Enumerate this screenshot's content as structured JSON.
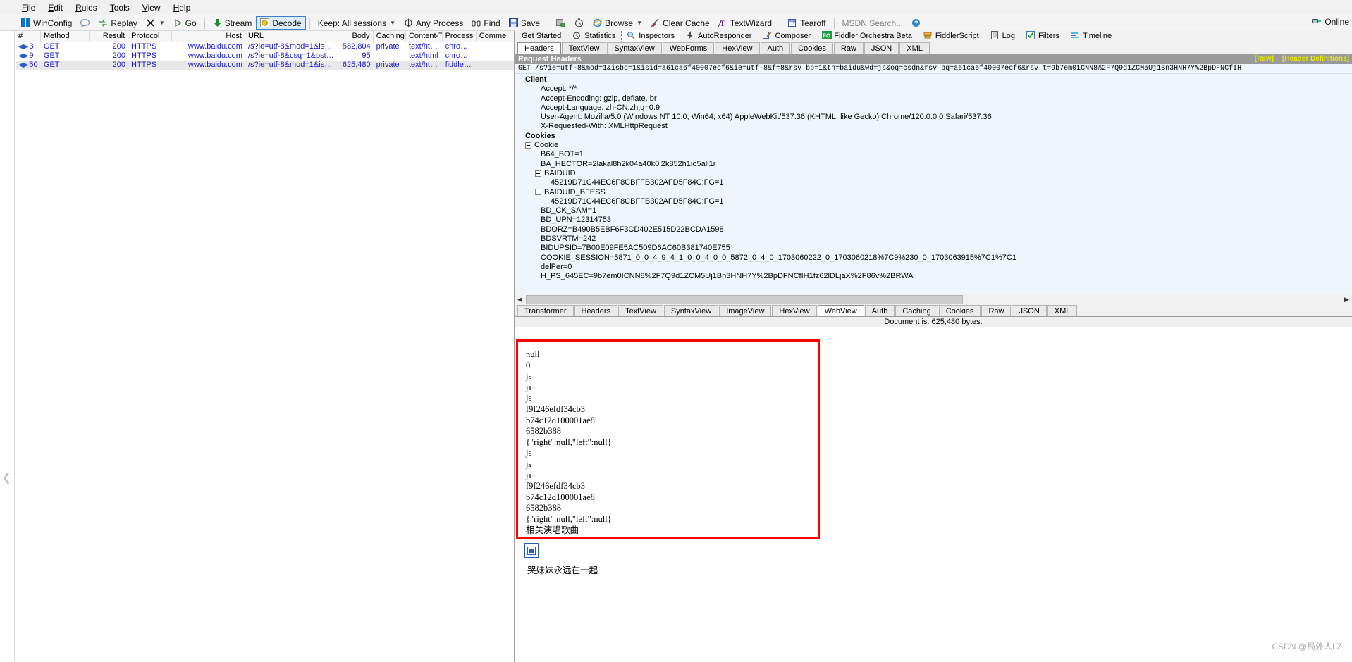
{
  "menu": {
    "items": [
      "File",
      "Edit",
      "Rules",
      "Tools",
      "View",
      "Help"
    ]
  },
  "toolbar": {
    "winconfig": "WinConfig",
    "replay": "Replay",
    "clear_x": "X",
    "go": "Go",
    "stream": "Stream",
    "decode": "Decode",
    "keep": "Keep: All sessions",
    "any_process": "Any Process",
    "find": "Find",
    "save": "Save",
    "browse": "Browse",
    "clear_cache": "Clear Cache",
    "textwizard": "TextWizard",
    "tearoff": "Tearoff",
    "msdn_search": "MSDN Search...",
    "online": "Online"
  },
  "grid": {
    "columns": [
      "#",
      "Method",
      "Result",
      "Protocol",
      "Host",
      "URL",
      "Body",
      "Caching",
      "Content-Type",
      "Process",
      "Comme"
    ],
    "rows": [
      {
        "num": "3",
        "method": "GET",
        "result": "200",
        "protocol": "HTTPS",
        "host": "www.baidu.com",
        "url": "/s?ie=utf-8&mod=1&isbd=...",
        "body": "582,804",
        "caching": "private",
        "content_type": "text/html;c...",
        "process": "chrome...",
        "comments": "",
        "selected": false
      },
      {
        "num": "9",
        "method": "GET",
        "result": "200",
        "protocol": "HTTPS",
        "host": "www.baidu.com",
        "url": "/s?ie=utf-8&csq=1&pstg=...",
        "body": "95",
        "caching": "",
        "content_type": "text/html",
        "process": "chrome...",
        "comments": "",
        "selected": false
      },
      {
        "num": "50",
        "method": "GET",
        "result": "200",
        "protocol": "HTTPS",
        "host": "www.baidu.com",
        "url": "/s?ie=utf-8&mod=1&isbd=...",
        "body": "625,480",
        "caching": "private",
        "content_type": "text/html;c...",
        "process": "fiddler:...",
        "comments": "",
        "selected": true
      }
    ]
  },
  "top_tabs": [
    {
      "label": "Get Started",
      "icon": "none",
      "active": false
    },
    {
      "label": "Statistics",
      "icon": "stopwatch-icon",
      "active": false
    },
    {
      "label": "Inspectors",
      "icon": "magnifier-icon",
      "active": true
    },
    {
      "label": "AutoResponder",
      "icon": "lightning-icon",
      "active": false
    },
    {
      "label": "Composer",
      "icon": "compose-icon",
      "active": false
    },
    {
      "label": "Fiddler Orchestra Beta",
      "icon": "fo-icon",
      "active": false
    },
    {
      "label": "FiddlerScript",
      "icon": "script-icon",
      "active": false
    },
    {
      "label": "Log",
      "icon": "log-icon",
      "active": false
    },
    {
      "label": "Filters",
      "icon": "checkbox-icon",
      "active": false
    },
    {
      "label": "Timeline",
      "icon": "timeline-icon",
      "active": false
    }
  ],
  "request_tabs": [
    {
      "label": "Headers",
      "active": true
    },
    {
      "label": "TextView",
      "active": false
    },
    {
      "label": "SyntaxView",
      "active": false
    },
    {
      "label": "WebForms",
      "active": false
    },
    {
      "label": "HexView",
      "active": false
    },
    {
      "label": "Auth",
      "active": false
    },
    {
      "label": "Cookies",
      "active": false
    },
    {
      "label": "Raw",
      "active": false
    },
    {
      "label": "JSON",
      "active": false
    },
    {
      "label": "XML",
      "active": false
    }
  ],
  "request_headers": {
    "title": "Request Headers",
    "raw_link": "[Raw]",
    "header_def_link": "[Header Definitions]",
    "request_line": "GET /s?ie=utf-8&mod=1&isbd=1&isid=a61ca6f40007ecf6&ie=utf-8&f=8&rsv_bp=1&tn=baidu&wd=js&oq=csdn&rsv_pq=a61ca6f40007ecf6&rsv_t=9b7em01CNN8%2F7Q9d1ZCM5Uj1Bn3HNH7Y%2BpDFNCfIH",
    "groups": [
      {
        "name": "Client",
        "items": [
          {
            "text": "Accept: */*",
            "indent": 1
          },
          {
            "text": "Accept-Encoding: gzip, deflate, br",
            "indent": 1
          },
          {
            "text": "Accept-Language: zh-CN,zh;q=0.9",
            "indent": 1
          },
          {
            "text": "User-Agent: Mozilla/5.0 (Windows NT 10.0; Win64; x64) AppleWebKit/537.36 (KHTML, like Gecko) Chrome/120.0.0.0 Safari/537.36",
            "indent": 1
          },
          {
            "text": "X-Requested-With: XMLHttpRequest",
            "indent": 1
          }
        ]
      },
      {
        "name": "Cookies",
        "items": [
          {
            "text": "Cookie",
            "indent": 2,
            "expander": true
          },
          {
            "text": "B64_BOT=1",
            "indent": 3
          },
          {
            "text": "BA_HECTOR=2lakal8h2k04a40k0l2k852h1io5ali1r",
            "indent": 3
          },
          {
            "text": "BAIDUID",
            "indent": 4,
            "expander": true
          },
          {
            "text": "45219D71C44EC6F8CBFFB302AFD5F84C:FG=1",
            "indent": 5
          },
          {
            "text": "BAIDUID_BFESS",
            "indent": 4,
            "expander": true
          },
          {
            "text": "45219D71C44EC6F8CBFFB302AFD5F84C:FG=1",
            "indent": 5
          },
          {
            "text": "BD_CK_SAM=1",
            "indent": 3
          },
          {
            "text": "BD_UPN=12314753",
            "indent": 3
          },
          {
            "text": "BDORZ=B490B5EBF6F3CD402E515D22BCDA1598",
            "indent": 3
          },
          {
            "text": "BDSVRTM=242",
            "indent": 3
          },
          {
            "text": "BIDUPSID=7B00E09FE5AC509D6AC60B381740E755",
            "indent": 3
          },
          {
            "text": "COOKIE_SESSION=5871_0_0_4_9_4_1_0_0_4_0_0_5872_0_4_0_1703060222_0_1703060218%7C9%230_0_1703063915%7C1%7C1",
            "indent": 3
          },
          {
            "text": "delPer=0",
            "indent": 3
          },
          {
            "text": "H_PS_645EC=9b7em0ICNN8%2F7Q9d1ZCM5Uj1Bn3HNH7Y%2BpDFNCfIH1fz62lDLjaX%2F86v%2BRWA",
            "indent": 3
          }
        ]
      }
    ]
  },
  "response_tabs": [
    {
      "label": "Transformer",
      "active": false
    },
    {
      "label": "Headers",
      "active": false
    },
    {
      "label": "TextView",
      "active": false
    },
    {
      "label": "SyntaxView",
      "active": false
    },
    {
      "label": "ImageView",
      "active": false
    },
    {
      "label": "HexView",
      "active": false
    },
    {
      "label": "WebView",
      "active": true
    },
    {
      "label": "Auth",
      "active": false
    },
    {
      "label": "Caching",
      "active": false
    },
    {
      "label": "Cookies",
      "active": false
    },
    {
      "label": "Raw",
      "active": false
    },
    {
      "label": "JSON",
      "active": false
    },
    {
      "label": "XML",
      "active": false
    }
  ],
  "document_info": "Document is: 625,480 bytes.",
  "webview": {
    "lines": [
      "null",
      "0",
      "js",
      "js",
      "js",
      "f9f246efdf34cb3",
      "b74c12d100001ae8",
      "6582b388",
      "{\"right\":null,\"left\":null}",
      "js",
      "js",
      "js",
      "f9f246efdf34cb3",
      "b74c12d100001ae8",
      "6582b388",
      "{\"right\":null,\"left\":null}",
      "相关演唱歌曲"
    ],
    "caption": "哭妹妹永远在一起",
    "highlight_color": "#ff0000"
  },
  "watermark": "CSDN @局外人LZ"
}
